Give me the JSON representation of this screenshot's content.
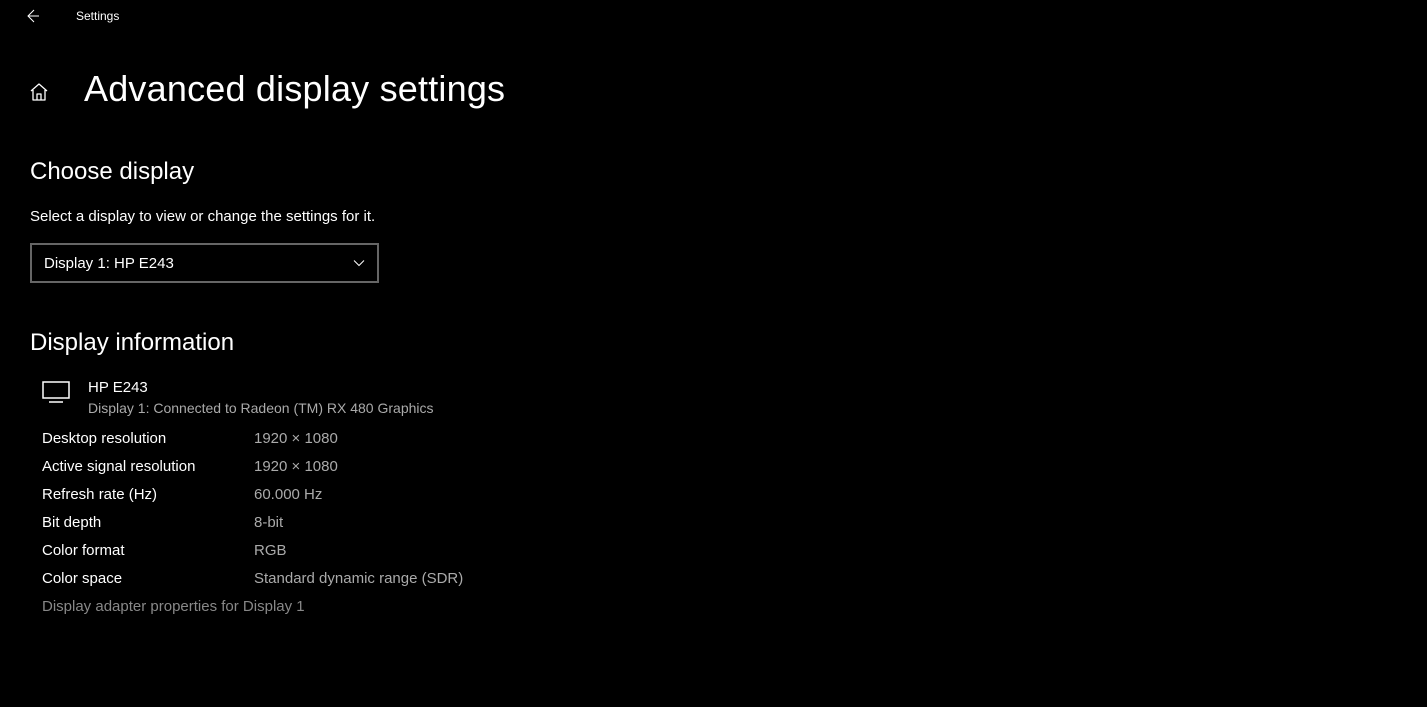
{
  "titlebar": {
    "app_name": "Settings"
  },
  "page": {
    "title": "Advanced display settings"
  },
  "choose_display": {
    "heading": "Choose display",
    "description": "Select a display to view or change the settings for it.",
    "dropdown_selected": "Display 1: HP E243"
  },
  "display_info": {
    "heading": "Display information",
    "monitor_name": "HP E243",
    "monitor_connection": "Display 1: Connected to Radeon (TM) RX 480 Graphics",
    "properties": [
      {
        "label": "Desktop resolution",
        "value": "1920 × 1080"
      },
      {
        "label": "Active signal resolution",
        "value": "1920 × 1080"
      },
      {
        "label": "Refresh rate (Hz)",
        "value": "60.000 Hz"
      },
      {
        "label": "Bit depth",
        "value": "8-bit"
      },
      {
        "label": "Color format",
        "value": "RGB"
      },
      {
        "label": "Color space",
        "value": "Standard dynamic range (SDR)"
      }
    ],
    "adapter_link": "Display adapter properties for Display 1"
  }
}
